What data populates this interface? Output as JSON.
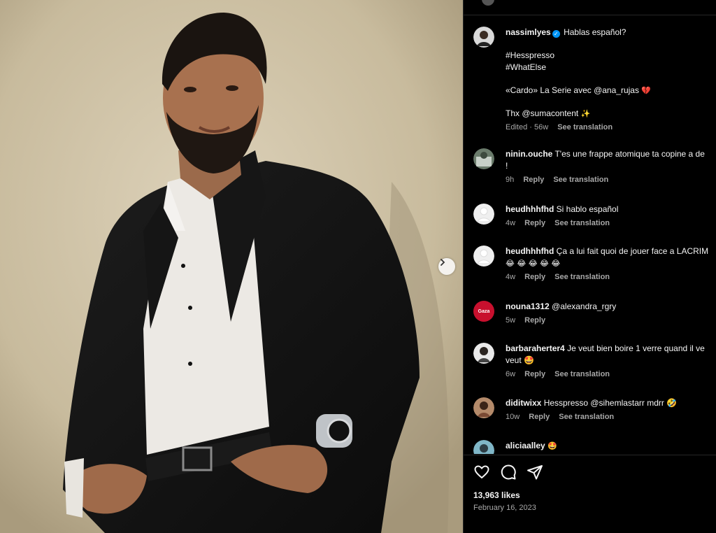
{
  "post": {
    "caption": {
      "username": "nassimlyes",
      "line1": "Hablas español?",
      "line2": "#Hesspresso",
      "line3": "#WhatElse",
      "line4": "«Cardo» La Serie avec @ana_rujas",
      "line4_emoji": "💔",
      "line5": "Thx @sumacontent",
      "line5_emoji": "✨",
      "edited": "Edited · 56w",
      "see_translation": "See translation"
    }
  },
  "comments": [
    {
      "username": "ninin.ouche",
      "text": "T'es une frappe atomique ta copine a de",
      "text2": "!",
      "time": "9h",
      "reply": "Reply",
      "translate": "See translation"
    },
    {
      "username": "heudhhhfhd",
      "text": "Si hablo español",
      "time": "4w",
      "reply": "Reply",
      "translate": "See translation"
    },
    {
      "username": "heudhhhfhd",
      "text": "Ça a lui fait quoi de jouer face a LACRIM",
      "text2": "😂 😂 😂 😂 😂",
      "time": "4w",
      "reply": "Reply",
      "translate": "See translation"
    },
    {
      "username": "nouna1312",
      "text": "@alexandra_rgry",
      "time": "5w",
      "reply": "Reply",
      "avatar_text": "Gaza"
    },
    {
      "username": "barbaraherter4",
      "text": "Je veut bien boire 1 verre quand il ve",
      "text2": "veut 🤩",
      "time": "6w",
      "reply": "Reply",
      "translate": "See translation"
    },
    {
      "username": "diditwixx",
      "text": "Hesspresso @sihemlastarr mdrr 🤣",
      "time": "10w",
      "reply": "Reply",
      "translate": "See translation"
    },
    {
      "username": "aliciaalley",
      "text": "🤩"
    }
  ],
  "footer": {
    "likes": "13,963 likes",
    "date": "February 16, 2023"
  },
  "colors": {
    "background": "#000000",
    "text": "#f5f5f5",
    "secondary": "#a8a8a8",
    "verified": "#0095f6",
    "divider": "#262626"
  },
  "icons": [
    "heart-icon",
    "comment-icon",
    "share-icon",
    "chevron-right-icon",
    "verified-icon"
  ]
}
